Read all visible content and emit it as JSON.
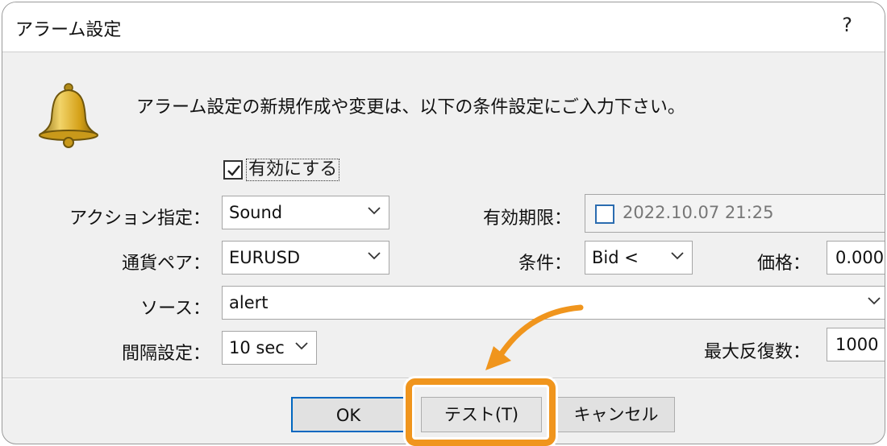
{
  "dialog": {
    "title": "アラーム設定",
    "help_label": "?",
    "message": "アラーム設定の新規作成や変更は、以下の条件設定にご入力下さい。",
    "enable": {
      "label": "有効にする",
      "checked": true
    }
  },
  "form": {
    "action": {
      "label": "アクション指定：",
      "value": "Sound"
    },
    "expiry": {
      "label": "有効期限：",
      "value": "2022.10.07 21:25",
      "checked": false
    },
    "symbol": {
      "label": "通貨ペア：",
      "value": "EURUSD"
    },
    "condition": {
      "label": "条件：",
      "value": "Bid <"
    },
    "price": {
      "label": "価格：",
      "value": "0.000"
    },
    "source": {
      "label": "ソース：",
      "value": "alert"
    },
    "interval": {
      "label": "間隔設定：",
      "value": "10 sec"
    },
    "max_iterations": {
      "label": "最大反復数：",
      "value": "1000"
    }
  },
  "buttons": {
    "ok": "OK",
    "test": "テスト(T)",
    "cancel": "キャンセル"
  },
  "colors": {
    "highlight": "#f0951d",
    "focus_border": "#0067c0",
    "bell": "#d4a017"
  },
  "icons": {
    "bell": "bell-icon",
    "chevron": "chevron-down-icon",
    "arrow": "curved-arrow-icon"
  }
}
